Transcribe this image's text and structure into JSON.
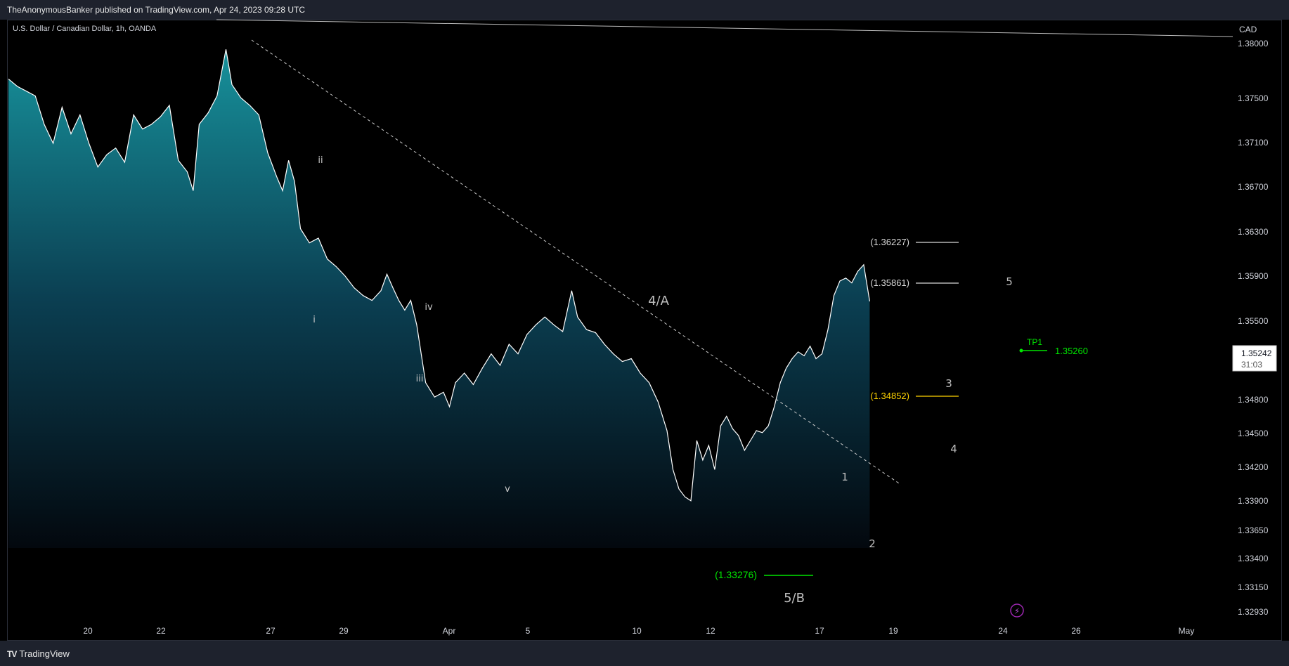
{
  "header": {
    "published": "TheAnonymousBanker published on TradingView.com, Apr 24, 2023 09:28 UTC"
  },
  "footer": {
    "brand": "TradingView",
    "brand_mark": "TV"
  },
  "colors": {
    "line": "#ffffff",
    "fill_top": "#138a94",
    "fill_bottom": "#041018",
    "green": "#00e600",
    "yellow": "#ffd400"
  },
  "chart_data": {
    "type": "area",
    "symbol": "U.S. Dollar / Canadian Dollar, 1h, OANDA",
    "currency": "CAD",
    "x_ticks": [
      "20",
      "22",
      "27",
      "29",
      "Apr",
      "5",
      "10",
      "12",
      "17",
      "19",
      "24",
      "26",
      "May"
    ],
    "y_ticks": [
      "1.38000",
      "1.37500",
      "1.37100",
      "1.36700",
      "1.36300",
      "1.35900",
      "1.35500",
      "1.34800",
      "1.34500",
      "1.34200",
      "1.33900",
      "1.33650",
      "1.33400",
      "1.33150",
      "1.32930"
    ],
    "last_price": "1.35242",
    "countdown": "31:03",
    "series": [
      {
        "x": 0,
        "y": 1.3758
      },
      {
        "x": 3,
        "y": 1.375
      },
      {
        "x": 6,
        "y": 1.3745
      },
      {
        "x": 9,
        "y": 1.374
      },
      {
        "x": 12,
        "y": 1.371
      },
      {
        "x": 15,
        "y": 1.369
      },
      {
        "x": 18,
        "y": 1.3728
      },
      {
        "x": 21,
        "y": 1.37
      },
      {
        "x": 24,
        "y": 1.372
      },
      {
        "x": 27,
        "y": 1.369
      },
      {
        "x": 30,
        "y": 1.3665
      },
      {
        "x": 33,
        "y": 1.3678
      },
      {
        "x": 36,
        "y": 1.3685
      },
      {
        "x": 39,
        "y": 1.367
      },
      {
        "x": 42,
        "y": 1.372
      },
      {
        "x": 45,
        "y": 1.3705
      },
      {
        "x": 48,
        "y": 1.371
      },
      {
        "x": 51,
        "y": 1.3718
      },
      {
        "x": 54,
        "y": 1.373
      },
      {
        "x": 57,
        "y": 1.3672
      },
      {
        "x": 60,
        "y": 1.366
      },
      {
        "x": 62,
        "y": 1.364
      },
      {
        "x": 64,
        "y": 1.371
      },
      {
        "x": 67,
        "y": 1.3722
      },
      {
        "x": 70,
        "y": 1.374
      },
      {
        "x": 73,
        "y": 1.379
      },
      {
        "x": 75,
        "y": 1.3752
      },
      {
        "x": 78,
        "y": 1.3738
      },
      {
        "x": 81,
        "y": 1.373
      },
      {
        "x": 84,
        "y": 1.372
      },
      {
        "x": 87,
        "y": 1.368
      },
      {
        "x": 90,
        "y": 1.3655
      },
      {
        "x": 92,
        "y": 1.364
      },
      {
        "x": 94,
        "y": 1.3672
      },
      {
        "x": 96,
        "y": 1.365
      },
      {
        "x": 98,
        "y": 1.36
      },
      {
        "x": 101,
        "y": 1.3585
      },
      {
        "x": 104,
        "y": 1.359
      },
      {
        "x": 107,
        "y": 1.3568
      },
      {
        "x": 110,
        "y": 1.356
      },
      {
        "x": 113,
        "y": 1.355
      },
      {
        "x": 116,
        "y": 1.3538
      },
      {
        "x": 119,
        "y": 1.353
      },
      {
        "x": 122,
        "y": 1.3525
      },
      {
        "x": 125,
        "y": 1.3535
      },
      {
        "x": 127,
        "y": 1.3552
      },
      {
        "x": 129,
        "y": 1.3538
      },
      {
        "x": 131,
        "y": 1.3525
      },
      {
        "x": 133,
        "y": 1.3515
      },
      {
        "x": 135,
        "y": 1.3525
      },
      {
        "x": 137,
        "y": 1.35
      },
      {
        "x": 140,
        "y": 1.344
      },
      {
        "x": 143,
        "y": 1.3425
      },
      {
        "x": 146,
        "y": 1.343
      },
      {
        "x": 148,
        "y": 1.3415
      },
      {
        "x": 150,
        "y": 1.344
      },
      {
        "x": 153,
        "y": 1.345
      },
      {
        "x": 156,
        "y": 1.3438
      },
      {
        "x": 159,
        "y": 1.3455
      },
      {
        "x": 162,
        "y": 1.347
      },
      {
        "x": 165,
        "y": 1.3458
      },
      {
        "x": 168,
        "y": 1.348
      },
      {
        "x": 171,
        "y": 1.347
      },
      {
        "x": 174,
        "y": 1.349
      },
      {
        "x": 177,
        "y": 1.35
      },
      {
        "x": 180,
        "y": 1.3508
      },
      {
        "x": 183,
        "y": 1.35
      },
      {
        "x": 186,
        "y": 1.3493
      },
      {
        "x": 189,
        "y": 1.3535
      },
      {
        "x": 191,
        "y": 1.3508
      },
      {
        "x": 194,
        "y": 1.3495
      },
      {
        "x": 197,
        "y": 1.3492
      },
      {
        "x": 200,
        "y": 1.348
      },
      {
        "x": 203,
        "y": 1.347
      },
      {
        "x": 206,
        "y": 1.3462
      },
      {
        "x": 209,
        "y": 1.3465
      },
      {
        "x": 212,
        "y": 1.345
      },
      {
        "x": 215,
        "y": 1.344
      },
      {
        "x": 218,
        "y": 1.342
      },
      {
        "x": 221,
        "y": 1.339
      },
      {
        "x": 223,
        "y": 1.335
      },
      {
        "x": 225,
        "y": 1.333
      },
      {
        "x": 227,
        "y": 1.3322
      },
      {
        "x": 229,
        "y": 1.3318
      },
      {
        "x": 231,
        "y": 1.338
      },
      {
        "x": 233,
        "y": 1.336
      },
      {
        "x": 235,
        "y": 1.3375
      },
      {
        "x": 237,
        "y": 1.335
      },
      {
        "x": 239,
        "y": 1.3395
      },
      {
        "x": 241,
        "y": 1.3405
      },
      {
        "x": 243,
        "y": 1.3392
      },
      {
        "x": 245,
        "y": 1.3385
      },
      {
        "x": 247,
        "y": 1.337
      },
      {
        "x": 249,
        "y": 1.338
      },
      {
        "x": 251,
        "y": 1.339
      },
      {
        "x": 253,
        "y": 1.3388
      },
      {
        "x": 255,
        "y": 1.3395
      },
      {
        "x": 257,
        "y": 1.3415
      },
      {
        "x": 259,
        "y": 1.344
      },
      {
        "x": 261,
        "y": 1.3455
      },
      {
        "x": 263,
        "y": 1.3465
      },
      {
        "x": 265,
        "y": 1.3472
      },
      {
        "x": 267,
        "y": 1.3468
      },
      {
        "x": 269,
        "y": 1.3478
      },
      {
        "x": 271,
        "y": 1.3465
      },
      {
        "x": 273,
        "y": 1.347
      },
      {
        "x": 275,
        "y": 1.3495
      },
      {
        "x": 277,
        "y": 1.353
      },
      {
        "x": 279,
        "y": 1.3545
      },
      {
        "x": 281,
        "y": 1.3548
      },
      {
        "x": 283,
        "y": 1.3543
      },
      {
        "x": 285,
        "y": 1.3555
      },
      {
        "x": 287,
        "y": 1.3562
      },
      {
        "x": 289,
        "y": 1.3524
      }
    ],
    "annotations": {
      "minor_waves": [
        "i",
        "ii",
        "iii",
        "iv",
        "v"
      ],
      "major_waves": [
        "4/A",
        "5/B",
        "1",
        "2",
        "3",
        "4",
        "5"
      ],
      "fib_levels": [
        "(1.36227)",
        "(1.35861)",
        "(1.34852)",
        "(1.33276)"
      ],
      "target_label": "TP1",
      "target_value": "1.35260"
    }
  }
}
